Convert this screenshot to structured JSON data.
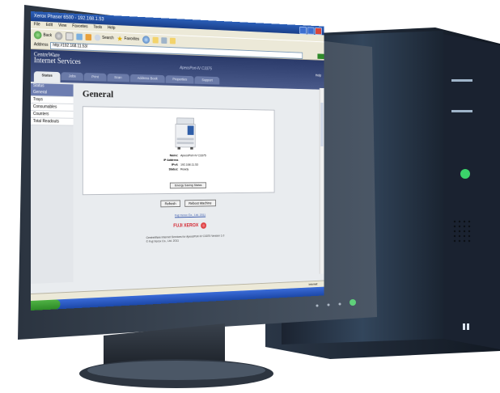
{
  "browser": {
    "title": "Xerox Phaser 6500 - 192.168.1.53",
    "menu": [
      "File",
      "Edit",
      "View",
      "Favorites",
      "Tools",
      "Help"
    ],
    "toolbar": {
      "back_label": "Back",
      "search_label": "Search",
      "favorites_label": "Favorites"
    },
    "address_label": "Address",
    "address_value": "http://192.168.11.53/"
  },
  "cw": {
    "logo_top": "CentreWare",
    "logo_bottom": "Internet Services",
    "device_name": "ApeosPort-IV C3375",
    "help_label": "Help"
  },
  "tabs": [
    {
      "label": "Status"
    },
    {
      "label": "Jobs"
    },
    {
      "label": "Print"
    },
    {
      "label": "Scan"
    },
    {
      "label": "Address Book"
    },
    {
      "label": "Properties"
    },
    {
      "label": "Support"
    }
  ],
  "sidebar": {
    "header": "Status",
    "items": [
      {
        "label": "General"
      },
      {
        "label": "Trays"
      },
      {
        "label": "Consumables"
      },
      {
        "label": "Counters"
      },
      {
        "label": "Total Readouts"
      }
    ]
  },
  "main": {
    "title": "General",
    "device_info": [
      {
        "key": "Name:",
        "value": "ApeosPort-IV C3375"
      },
      {
        "key": "IP Address",
        "value": ""
      },
      {
        "key": "IPv4:",
        "value": "192.168.11.53"
      },
      {
        "key": "Status:",
        "value": "Ready"
      }
    ],
    "energy_button": "Energy Saving Status",
    "refresh_button": "Refresh",
    "reboot_button": "Reboot Machine",
    "link_text": "Fuji Xerox Co., Ltd. 2011",
    "brand": "FUJI XEROX",
    "footer_line1": "CentreWare Internet Services for ApeosPort-IV C3375 Version 1.0",
    "footer_line2": "© Fuji Xerox Co., Ltd. 2011"
  },
  "statusbar": {
    "zone": "Internet"
  }
}
